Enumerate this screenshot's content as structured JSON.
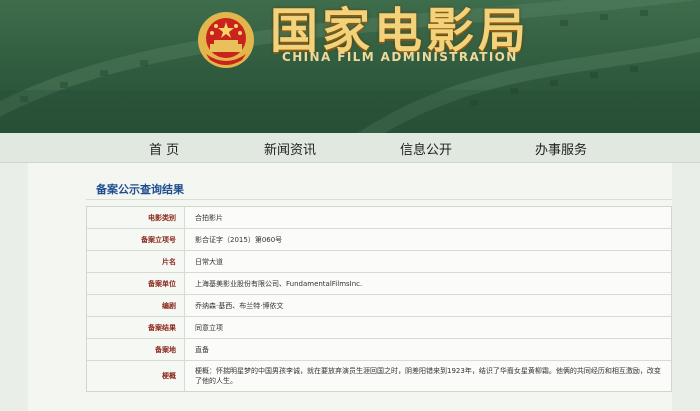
{
  "header": {
    "title_cn": "国家电影局",
    "title_en": "CHINA FILM ADMINISTRATION"
  },
  "nav": {
    "items": [
      {
        "label": "首 页"
      },
      {
        "label": "新闻资讯"
      },
      {
        "label": "信息公开"
      },
      {
        "label": "办事服务"
      }
    ]
  },
  "section": {
    "title": "备案公示查询结果"
  },
  "record": {
    "rows": [
      {
        "label": "电影类别",
        "value": "合拍影片"
      },
      {
        "label": "备案立项号",
        "value": "影合证字（2015）第060号"
      },
      {
        "label": "片名",
        "value": "日常大道"
      },
      {
        "label": "备案单位",
        "value": "上海基美影业股份有限公司、FundamentalFilmsInc."
      },
      {
        "label": "编剧",
        "value": "乔纳森·基西、布兰特·博依文"
      },
      {
        "label": "备案结果",
        "value": "同意立项"
      },
      {
        "label": "备案地",
        "value": "直备"
      },
      {
        "label": "梗概",
        "value": "梗概：怀揣明星梦的中国男孩李诚，就在要放弃演员生涯回国之时，阴差阳错来到1923年，结识了华裔女星黄柳霜。他俩的共同经历和相互激励，改变了他的人生。"
      }
    ]
  },
  "colors": {
    "banner_green": "#2f5a3e",
    "title_gold": "#f2d27a",
    "section_title_blue": "#1f4d8f",
    "label_red": "#8b2a1e"
  }
}
